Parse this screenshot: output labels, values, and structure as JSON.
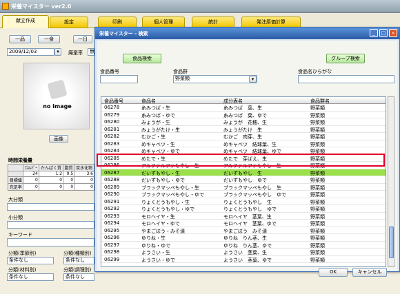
{
  "app": {
    "title": "栄養マイスター ver2.0"
  },
  "tabs": [
    {
      "label": "献立作成"
    },
    {
      "label": "設定"
    },
    {
      "label": "印刷"
    },
    {
      "label": "個人管理"
    },
    {
      "label": "統計"
    },
    {
      "label": "発注原価計算"
    }
  ],
  "left": {
    "btn_ippin": "一品",
    "btn_ichishoku": "一食",
    "btn_ichinichi": "一日",
    "date": "2009/12/03",
    "haiki_label": "廃棄率",
    "haiki_value": "無",
    "noimage": "no image",
    "image_btn": "画像",
    "nutrition_label": "時間栄養量",
    "nut_headers": [
      "ｴﾈﾙｷﾞｰ",
      "たんぱく質",
      "脂質",
      "炭水化物"
    ],
    "nut_rows": [
      {
        "label": "",
        "vals": [
          "24",
          "1.2",
          "0.5",
          "3.6"
        ]
      },
      {
        "label": "目標値",
        "vals": [
          "0",
          "0",
          "0",
          "0"
        ]
      },
      {
        "label": "充足率",
        "vals": [
          "0",
          "0",
          "0",
          "0"
        ]
      }
    ],
    "daibunrui": "大分類",
    "shobunrui": "小分類",
    "keyword": "キーワード",
    "bunrui_kisetsu": "分類(季節別)",
    "bunrui_shurui": "分類(種類別)",
    "bunrui_zairyo": "分類(材料別)",
    "bunrui_chori": "分類(調理別)",
    "jouken_nashi": "条件なし"
  },
  "dialog": {
    "title": "栄養マイスター - 検索",
    "food_search_btn": "食品検索",
    "group_search_btn": "グループ検索",
    "code_label": "食品番号",
    "group_label": "食品群",
    "group_value": "野菜類",
    "kana_label": "食品名ひらがな",
    "columns": [
      "食品番号",
      "食品名",
      "成分表名",
      "食品群名"
    ],
    "rows": [
      [
        "06278",
        "糸みつば・生",
        "糸みつば　葉、生",
        "野菜類"
      ],
      [
        "06279",
        "糸みつば・ゆで",
        "糸みつば　葉、ゆで",
        "野菜類"
      ],
      [
        "06280",
        "みょうが・生",
        "みょうが　花穂、生",
        "野菜類"
      ],
      [
        "06281",
        "みょうがたけ・生",
        "みょうがたけ　生",
        "野菜類"
      ],
      [
        "06282",
        "むかご・生",
        "むかご　肉芽、生",
        "野菜類"
      ],
      [
        "06283",
        "めキャベツ・生",
        "めキャベツ　結球葉、生",
        "野菜類"
      ],
      [
        "06284",
        "めキャベツ・ゆで",
        "めキャベツ　結球葉、ゆで",
        "野菜類"
      ],
      [
        "06285",
        "めたで・生",
        "めたで　芽ばえ、生",
        "野菜類"
      ],
      [
        "06286",
        "アルファルファもやし・生",
        "アルファルファもやし　生",
        "野菜類"
      ],
      [
        "06287",
        "だいずもやし・生",
        "だいずもやし　生",
        "野菜類"
      ],
      [
        "06288",
        "だいずもやし・ゆで",
        "だいずもやし　ゆで",
        "野菜類"
      ],
      [
        "06289",
        "ブラックマッペもやし・生",
        "ブラックマッペもやし　生",
        "野菜類"
      ],
      [
        "06290",
        "ブラックマッペもやし・ゆで",
        "ブラックマッペもやし　ゆで",
        "野菜類"
      ],
      [
        "06291",
        "りょくとうもやし・生",
        "りょくとうもやし　生",
        "野菜類"
      ],
      [
        "06292",
        "りょくとうもやし・ゆで",
        "りょくとうもやし　ゆで",
        "野菜類"
      ],
      [
        "06293",
        "モロヘイヤ・生",
        "モロヘイヤ　茎葉、生",
        "野菜類"
      ],
      [
        "06294",
        "モロヘイヤ・ゆで",
        "モロヘイヤ　茎葉、ゆで",
        "野菜類"
      ],
      [
        "06295",
        "やまごぼう・みそ漬",
        "やまごぼう　みそ漬",
        "野菜類"
      ],
      [
        "06296",
        "ゆりね・生",
        "ゆりね　りん茎、生",
        "野菜類"
      ],
      [
        "06297",
        "ゆりね・ゆで",
        "ゆりね　りん茎、ゆで",
        "野菜類"
      ],
      [
        "06298",
        "ようさい・生",
        "ようさい　茎葉、生",
        "野菜類"
      ],
      [
        "06299",
        "ようさい・ゆで",
        "ようさい　茎葉、ゆで",
        "野菜類"
      ]
    ],
    "selected_row": 9,
    "ok_btn": "OK",
    "cancel_btn": "キャンセル"
  }
}
